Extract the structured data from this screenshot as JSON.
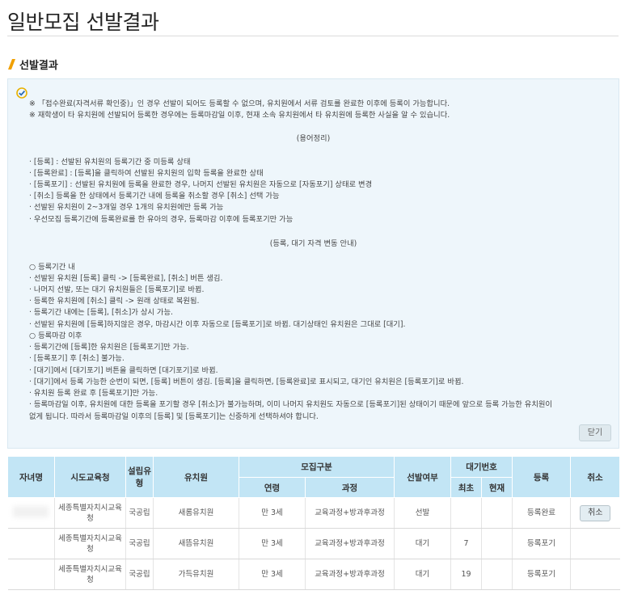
{
  "page": {
    "title": "일반모집 선발결과"
  },
  "section": {
    "title": "선발결과"
  },
  "notice": {
    "lines": [
      "※ 「접수완료(자격서류 확인중)」인 경우 선발이 되어도 등록할 수 없으며, 유치원에서 서류 검토를 완료한 이후에 등록이 가능합니다.",
      "※ 재학생이 타 유치원에 선발되어 등록한 경우에는 등록마감일 이후, 현재 소속 유치원에서 타 유치원에 등록한 사실을 알 수 있습니다.",
      "(용어정리)",
      "· [등록] : 선발된 유치원의 등록기간 중 미등록 상태",
      "· [등록완료] : [등록]을 클릭하여 선발된 유치원의 입학 등록을 완료한 상태",
      "· [등록포기] : 선발된 유치원에 등록을 완료한 경우, 나머지 선발된 유치원은 자동으로 [자동포기] 상태로 변경",
      "· [취소] 등록을 한 상태에서 등록기간 내에 등록을 취소할 경우 [취소] 선택 가능",
      "· 선발된 유치원이 2~3개일 경우 1개의 유치원에만 등록 가능",
      "· 우선모집 등록기간에 등록완료를 한 유아의 경우, 등록마감 이후에 등록포기만 가능",
      "(등록, 대기 자격 변동 안내)",
      "○ 등록기간 내",
      "· 선발된 유치원 [등록] 클릭 -> [등록완료], [취소] 버튼 생김.",
      "· 나머지 선발, 또는 대기 유치원들은 [등록포기]로 바뀜.",
      "· 등록한 유치원에 [취소] 클릭 -> 원래 상태로 복원됨.",
      "· 등록기간 내에는 [등록], [취소]가 상시 가능.",
      "· 선발된 유치원에 [등록]하지않은 경우, 마감시간 이후 자동으로 [등록포기]로 바뀜. 대기상태인 유치원은 그대로 [대기].",
      "○ 등록마감 이후",
      "· 등록기간에 [등록]한 유치원은 [등록포기]만 가능.",
      "· [등록포기] 후 [취소] 불가능.",
      "· [대기]에서 [대기포기] 버튼을 클릭하면 [대기포기]로 바뀜.",
      "· [대기]에서 등록 가능한 순번이 되면, [등록] 버튼이 생김. [등록]을 클릭하면, [등록완료]로 표시되고, 대기인 유치원은 [등록포기]로 바뀜.",
      "· 유치원 등록 완료 후 [등록포기]만 가능.",
      "· 등록마감일 이후, 유치원에 대한 등록을 포기할 경우 [취소]가 불가능하며, 이미 나머지 유치원도 자동으로 [등록포기]된 상태이기 때문에 앞으로 등록 가능한 유치원이",
      "없게 됩니다. 따라서 등록마감일 이후의 [등록] 및 [등록포기]는 신중하게 선택하셔야 합니다."
    ],
    "close_label": "닫기"
  },
  "table": {
    "headers": {
      "child_name": "자녀명",
      "office": "시도교육청",
      "type": "설립유형",
      "kindergarten": "유치원",
      "recruit_group": "모집구분",
      "age": "연령",
      "course": "과정",
      "selected": "선발여부",
      "wait_no": "대기번호",
      "first": "최초",
      "current": "현재",
      "register": "등록",
      "cancel": "취소"
    },
    "rows": [
      {
        "office": "세종특별자치시교육청",
        "type": "국공립",
        "kindergarten": "새롬유치원",
        "age": "만 3세",
        "course": "교육과정+방과후과정",
        "selected": "선발",
        "first": "",
        "current": "",
        "register": "등록완료",
        "cancel": "취소"
      },
      {
        "office": "세종특별자치시교육청",
        "type": "국공립",
        "kindergarten": "새뜸유치원",
        "age": "만 3세",
        "course": "교육과정+방과후과정",
        "selected": "대기",
        "first": "7",
        "current": "",
        "register": "등록포기",
        "cancel": ""
      },
      {
        "office": "세종특별자치시교육청",
        "type": "국공립",
        "kindergarten": "가득유치원",
        "age": "만 3세",
        "course": "교육과정+방과후과정",
        "selected": "대기",
        "first": "19",
        "current": "",
        "register": "등록포기",
        "cancel": ""
      }
    ]
  }
}
